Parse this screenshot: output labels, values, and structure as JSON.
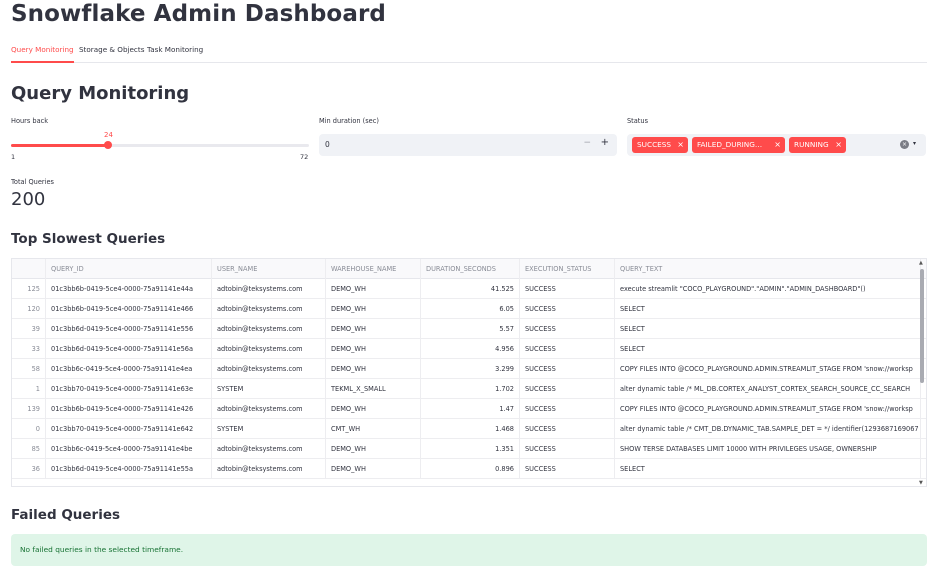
{
  "app": {
    "title": "Snowflake Admin Dashboard"
  },
  "tabs": [
    {
      "label": "Query Monitoring",
      "active": true
    },
    {
      "label": "Storage & Objects",
      "active": false
    },
    {
      "label": "Task Monitoring",
      "active": false
    }
  ],
  "section": {
    "title": "Query Monitoring"
  },
  "filters": {
    "hours_back": {
      "label": "Hours back",
      "value": "24",
      "min": "1",
      "max": "72",
      "fraction": 0.324
    },
    "min_duration": {
      "label": "Min duration (sec)",
      "value": "0",
      "minus": "−",
      "plus": "+"
    },
    "status": {
      "label": "Status",
      "tags": [
        "SUCCESS",
        "FAILED_DURING…",
        "RUNNING"
      ],
      "tag_remove": "×",
      "clear_icon": "×",
      "dropdown_icon": "▾"
    }
  },
  "metric": {
    "label": "Total Queries",
    "value": "200"
  },
  "slowest": {
    "title": "Top Slowest Queries",
    "columns": [
      "",
      "QUERY_ID",
      "USER_NAME",
      "WAREHOUSE_NAME",
      "DURATION_SECONDS",
      "EXECUTION_STATUS",
      "QUERY_TEXT"
    ],
    "rows": [
      [
        "125",
        "01c3bb6b-0419-5ce4-0000-75a91141e44a",
        "adtobin@teksystems.com",
        "DEMO_WH",
        "41.525",
        "SUCCESS",
        "execute streamlit \"COCO_PLAYGROUND\".\"ADMIN\".\"ADMIN_DASHBOARD\"()"
      ],
      [
        "120",
        "01c3bb6b-0419-5ce4-0000-75a91141e466",
        "adtobin@teksystems.com",
        "DEMO_WH",
        "6.05",
        "SUCCESS",
        "SELECT"
      ],
      [
        "39",
        "01c3bb6d-0419-5ce4-0000-75a91141e556",
        "adtobin@teksystems.com",
        "DEMO_WH",
        "5.57",
        "SUCCESS",
        "SELECT"
      ],
      [
        "33",
        "01c3bb6d-0419-5ce4-0000-75a91141e56a",
        "adtobin@teksystems.com",
        "DEMO_WH",
        "4.956",
        "SUCCESS",
        "SELECT"
      ],
      [
        "58",
        "01c3bb6c-0419-5ce4-0000-75a91141e4ea",
        "adtobin@teksystems.com",
        "DEMO_WH",
        "3.299",
        "SUCCESS",
        "COPY FILES INTO @COCO_PLAYGROUND.ADMIN.STREAMLIT_STAGE FROM 'snow://worksp"
      ],
      [
        "1",
        "01c3bb70-0419-5ce4-0000-75a91141e63e",
        "SYSTEM",
        "TEKML_X_SMALL",
        "1.702",
        "SUCCESS",
        "alter dynamic table /* ML_DB.CORTEX_ANALYST_CORTEX_SEARCH_SOURCE_CC_SEARCH"
      ],
      [
        "139",
        "01c3bb6b-0419-5ce4-0000-75a91141e426",
        "adtobin@teksystems.com",
        "DEMO_WH",
        "1.47",
        "SUCCESS",
        "COPY FILES INTO @COCO_PLAYGROUND.ADMIN.STREAMLIT_STAGE FROM 'snow://worksp"
      ],
      [
        "0",
        "01c3bb70-0419-5ce4-0000-75a91141e642",
        "SYSTEM",
        "CMT_WH",
        "1.468",
        "SUCCESS",
        "alter dynamic table /* CMT_DB.DYNAMIC_TAB.SAMPLE_DET = */ identifier(1293687169067"
      ],
      [
        "85",
        "01c3bb6c-0419-5ce4-0000-75a91141e4be",
        "adtobin@teksystems.com",
        "DEMO_WH",
        "1.351",
        "SUCCESS",
        "SHOW TERSE DATABASES LIMIT 10000 WITH PRIVILEGES USAGE, OWNERSHIP"
      ],
      [
        "36",
        "01c3bb6d-0419-5ce4-0000-75a91141e55a",
        "adtobin@teksystems.com",
        "DEMO_WH",
        "0.896",
        "SUCCESS",
        "SELECT"
      ]
    ],
    "scroll_up": "▲",
    "scroll_down": "▼"
  },
  "failed": {
    "title": "Failed Queries",
    "message": "No failed queries in the selected timeframe."
  }
}
